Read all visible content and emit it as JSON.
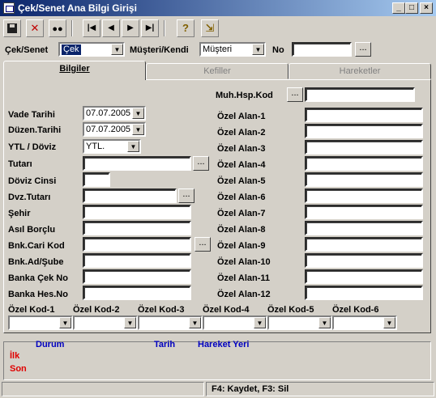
{
  "window": {
    "title": "Çek/Senet Ana Bilgi Girişi"
  },
  "window_buttons": [
    "_",
    "□",
    "×"
  ],
  "toolbar": {
    "save_icon": "floppy-icon",
    "delete_icon": "red-x-icon",
    "search_icon": "binoculars-icon",
    "first_icon": "first-record-icon",
    "prev_icon": "prev-record-icon",
    "next_icon": "next-record-icon",
    "last_icon": "last-record-icon",
    "help_icon": "question-icon",
    "exit_icon": "exit-door-icon",
    "glyphs": {
      "save": "💾",
      "delete": "✕",
      "search": "🔭",
      "first": "|◀",
      "prev": "◀",
      "next": "▶",
      "last": "▶|",
      "help": "?",
      "exit": "⇲"
    }
  },
  "header": {
    "cek_senet_label": "Çek/Senet",
    "cek_senet_value": "Çek",
    "musteri_label": "Müşteri/Kendi",
    "musteri_value": "Müşteri",
    "no_label": "No",
    "no_value": "",
    "dots": "..."
  },
  "tabs": [
    {
      "label": "Bilgiler",
      "active": true
    },
    {
      "label": "Kefiller",
      "active": false
    },
    {
      "label": "Hareketler",
      "active": false
    }
  ],
  "left_fields": {
    "vade_tarihi": {
      "label": "Vade Tarihi",
      "value": "07.07.2005"
    },
    "duzen_tarihi": {
      "label": "Düzen.Tarihi",
      "value": "07.07.2005"
    },
    "ytl_doviz": {
      "label": "YTL / Döviz",
      "value": "YTL."
    },
    "tutari": {
      "label": "Tutarı",
      "value": ""
    },
    "doviz_cinsi": {
      "label": "Döviz Cinsi",
      "value": ""
    },
    "dvz_tutari": {
      "label": "Dvz.Tutarı",
      "value": ""
    },
    "sehir": {
      "label": "Şehir",
      "value": ""
    },
    "asil_borclu": {
      "label": "Asıl Borçlu",
      "value": ""
    },
    "bnk_cari_kod": {
      "label": "Bnk.Cari Kod",
      "value": ""
    },
    "bnk_ad_sube": {
      "label": "Bnk.Ad/Şube",
      "value": ""
    },
    "banka_cek_no": {
      "label": "Banka Çek No",
      "value": ""
    },
    "banka_hes_no": {
      "label": "Banka Hes.No",
      "value": ""
    }
  },
  "right_fields": {
    "muh_hsp_kod": {
      "label": "Muh.Hsp.Kod",
      "value": ""
    },
    "ozel_alanlar": [
      {
        "label": "Özel Alan-1",
        "value": ""
      },
      {
        "label": "Özel Alan-2",
        "value": ""
      },
      {
        "label": "Özel Alan-3",
        "value": ""
      },
      {
        "label": "Özel Alan-4",
        "value": ""
      },
      {
        "label": "Özel Alan-5",
        "value": ""
      },
      {
        "label": "Özel Alan-6",
        "value": ""
      },
      {
        "label": "Özel Alan-7",
        "value": ""
      },
      {
        "label": "Özel Alan-8",
        "value": ""
      },
      {
        "label": "Özel Alan-9",
        "value": ""
      },
      {
        "label": "Özel Alan-10",
        "value": ""
      },
      {
        "label": "Özel Alan-11",
        "value": ""
      },
      {
        "label": "Özel Alan-12",
        "value": ""
      }
    ]
  },
  "ozel_kodlar": [
    {
      "label": "Özel Kod-1",
      "value": ""
    },
    {
      "label": "Özel Kod-2",
      "value": ""
    },
    {
      "label": "Özel Kod-3",
      "value": ""
    },
    {
      "label": "Özel Kod-4",
      "value": ""
    },
    {
      "label": "Özel Kod-5",
      "value": ""
    },
    {
      "label": "Özel Kod-6",
      "value": ""
    }
  ],
  "history": {
    "col_durum": "Durum",
    "col_tarih": "Tarih",
    "col_hareket_yeri": "Hareket Yeri",
    "row_ilk": "İlk",
    "row_son": "Son",
    "header_color": "#0000c0",
    "row_color": "#e00000"
  },
  "status_bar": {
    "left": "",
    "right": "F4: Kaydet, F3: Sil"
  }
}
